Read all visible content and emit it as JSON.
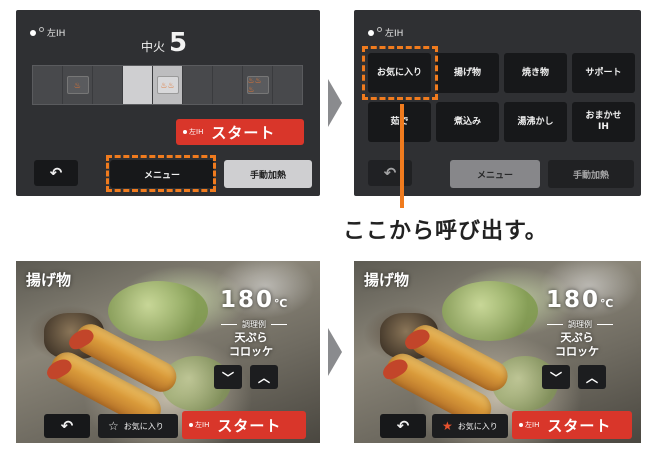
{
  "ih_indicator": "左IH",
  "panel1": {
    "heat_label": "中火",
    "heat_value": "5",
    "level_icons": [
      "♨",
      "♨♨",
      "♨♨♨"
    ],
    "start_small": "左IH",
    "start_label": "スタート",
    "back_glyph": "↶",
    "menu_label": "メニュー",
    "manual_label": "手動加熱"
  },
  "panel2": {
    "menu_items": [
      "お気に入り",
      "揚げ物",
      "焼き物",
      "サポート",
      "茹で",
      "煮込み",
      "湯沸かし",
      "おまかせ IH"
    ],
    "back_glyph": "↶",
    "menu_label": "メニュー",
    "manual_label": "手動加熱"
  },
  "caption": "ここから呼び出す。",
  "photo_panels": [
    {
      "title": "揚げ物",
      "temp_value": "180",
      "temp_unit": "℃",
      "example_label": "調理例",
      "recipe_1": "天ぷら",
      "recipe_2": "コロッケ",
      "down_glyph": "﹀",
      "up_glyph": "︿",
      "back_glyph": "↶",
      "fav_label": "お気に入り",
      "start_small": "左IH",
      "start_label": "スタート",
      "favorited": false
    },
    {
      "title": "揚げ物",
      "temp_value": "180",
      "temp_unit": "℃",
      "example_label": "調理例",
      "recipe_1": "天ぷら",
      "recipe_2": "コロッケ",
      "down_glyph": "﹀",
      "up_glyph": "︿",
      "back_glyph": "↶",
      "fav_label": "お気に入り",
      "start_small": "左IH",
      "start_label": "スタート",
      "favorited": true
    }
  ],
  "colors": {
    "accent_orange": "#f07b1e",
    "start_red": "#d9362a",
    "panel_dark": "#2f3033"
  }
}
